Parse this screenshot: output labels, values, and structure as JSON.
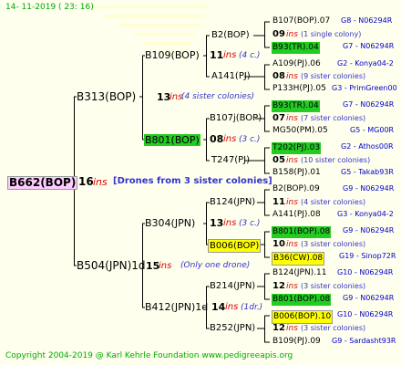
{
  "date": "14- 11-2019 ( 23: 16)",
  "copyright": "Copyright 2004-2019 @ Karl Kehrle Foundation   www.pedigreeapis.org",
  "colors": {
    "background": "#ffffee",
    "line": "#000000",
    "ins_text": "#dd0000",
    "note_text": "#3333cc",
    "code_text": "#0000cc",
    "date_text": "#00aa00",
    "green_box": "#22cc22",
    "yellow_box": "#ffff00",
    "root_box": "#ffccff"
  },
  "root": {
    "name": "B662(BOP)",
    "ins": "16",
    "ins_word": "ins",
    "note": "[Drones from 3 sister colonies]"
  },
  "gen1": [
    {
      "name": "B313(BOP)",
      "ins": "13",
      "ins_word": "ins",
      "note": "(4 sister colonies)"
    },
    {
      "name": "B504(JPN)1d",
      "ins": "15",
      "ins_word": "ins",
      "note": "(Only one drone)"
    }
  ],
  "gen2": [
    {
      "name": "B109(BOP)",
      "ins": "11",
      "ins_word": "ins",
      "note": "(4 c.)"
    },
    {
      "name": "B801(BOP)",
      "ins": "08",
      "ins_word": "ins",
      "note": "(3 c.)"
    },
    {
      "name": "B304(JPN)",
      "ins": "13",
      "ins_word": "ins",
      "note": "(3 c.)"
    },
    {
      "name": "B412(JPN)1d",
      "ins": "14",
      "ins_word": "ins",
      "note": "(1dr.)"
    }
  ],
  "gen3": [
    {
      "name": "B2(BOP)",
      "ins": "09",
      "ins_word": "ins",
      "note": "(1 single colony)",
      "father": "B107(BOP).07",
      "father_code": "G8 - N06294R",
      "mother": "B93(TR).04",
      "mother_code": "G7 - N06294R"
    },
    {
      "name": "A141(PJ)",
      "ins": "08",
      "ins_word": "ins",
      "note": "(9 sister colonies)",
      "father": "A109(PJ).06",
      "father_code": "G2 - Konya04-2",
      "mother": "P133H(PJ).05",
      "mother_code": "G3 - PrimGreen00"
    },
    {
      "name": "B107j(BOP)",
      "ins": "07",
      "ins_word": "ins",
      "note": "(7 sister colonies)",
      "father": "B93(TR).04",
      "father_code": "G7 - N06294R",
      "mother": "MG50(PM).05",
      "mother_code": "G5 - MG00R"
    },
    {
      "name": "T247(PJ)",
      "ins": "05",
      "ins_word": "ins",
      "note": "(10 sister colonies)",
      "father": "T202(PJ).03",
      "father_code": "G2 - Athos00R",
      "mother": "B158(PJ).01",
      "mother_code": "G5 - Takab93R"
    },
    {
      "name": "B124(JPN)",
      "ins": "11",
      "ins_word": "ins",
      "note": "(4 sister colonies)",
      "father": "B2(BOP).09",
      "father_code": "G9 - N06294R",
      "mother": "A141(PJ).08",
      "mother_code": "G3 - Konya04-2"
    },
    {
      "name": "B006(BOP)",
      "ins": "10",
      "ins_word": "ins",
      "note": "(3 sister colonies)",
      "father": "B801(BOP).08",
      "father_code": "G9 - N06294R",
      "mother": "B36(CW).08",
      "mother_code": "G19 - Sinop72R"
    },
    {
      "name": "B214(JPN)",
      "ins": "12",
      "ins_word": "ins",
      "note": "(3 sister colonies)",
      "father": "B124(JPN).11",
      "father_code": "G10 - N06294R",
      "mother": "B801(BOP).08",
      "mother_code": "G9 - N06294R"
    },
    {
      "name": "B252(JPN)",
      "ins": "12",
      "ins_word": "ins",
      "note": "(3 sister colonies)",
      "father": "B006(BOP).10",
      "father_code": "G10 - N06294R",
      "mother": "B109(PJ).09",
      "mother_code": "G9 - Sardasht93R"
    }
  ]
}
